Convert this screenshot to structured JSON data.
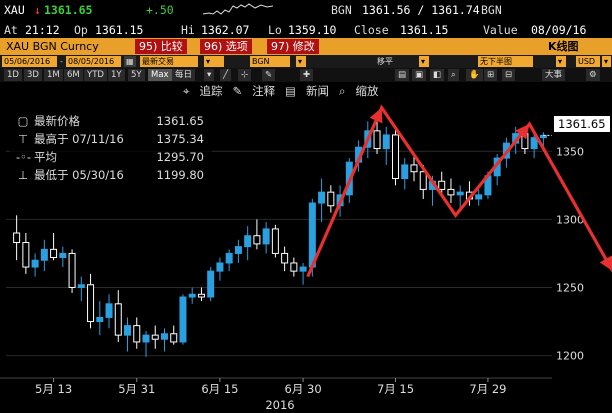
{
  "ticker": {
    "symbol": "XAU",
    "arrow": "↓",
    "last": "1361.65",
    "change": "+.50",
    "source": "BGN",
    "bid_ask": "1361.56 / 1361.74",
    "source2": "BGN",
    "at_label": "At",
    "time": "21:12",
    "op_label": "Op",
    "open": "1361.15",
    "hi_label": "Hi",
    "high": "1362.07",
    "lo_label": "Lo",
    "low": "1359.10",
    "close_label": "Close",
    "close": "1361.15",
    "value_label": "Value",
    "value_date": "08/09/16"
  },
  "function_bar": {
    "security": "XAU BGN Curncy",
    "btn1": "95) 比较",
    "btn2": "96) 选项",
    "btn3": "97) 修改",
    "chart_type": "K线图"
  },
  "controls": {
    "start_date": "05/06/2016",
    "dash": "-",
    "end_date": "08/05/2016",
    "trade_label": "最新交易",
    "source": "BGN",
    "pan_label": "移平",
    "no_half": "无下半图",
    "currency": "USD"
  },
  "periods": [
    "1D",
    "3D",
    "1M",
    "6M",
    "YTD",
    "1Y",
    "5Y",
    "Max",
    "每日"
  ],
  "toolbar": {
    "trace": "追踪",
    "annotate": "注释",
    "news": "新闻",
    "zoom": "缩放",
    "large": "大事"
  },
  "legend": {
    "rows": [
      {
        "label": "最新价格",
        "value": "1361.65"
      },
      {
        "label": "最高于 07/11/16",
        "value": "1375.34"
      },
      {
        "label": "平均",
        "value": "1295.70"
      },
      {
        "label": "最低于 05/30/16",
        "value": "1199.80"
      }
    ]
  },
  "last_price_tag": "1361.65",
  "colors": {
    "up": "#2aa0e0",
    "down": "#ffffff",
    "annotation": "#e83030",
    "function_bar": "#e8a02a",
    "positive_change": "#3ad13a"
  },
  "chart_data": {
    "type": "candlestick",
    "x_ticks": [
      "5月 13",
      "5月 31",
      "6月 15",
      "6月 30",
      "7月 15",
      "7月 29"
    ],
    "x_year": "2016",
    "y_ticks": [
      1200,
      1250,
      1300,
      1350
    ],
    "ylim": [
      1185,
      1395
    ],
    "candles": [
      {
        "o": 1290,
        "h": 1303,
        "l": 1270,
        "c": 1283
      },
      {
        "o": 1283,
        "h": 1290,
        "l": 1260,
        "c": 1265
      },
      {
        "o": 1265,
        "h": 1275,
        "l": 1258,
        "c": 1270
      },
      {
        "o": 1270,
        "h": 1285,
        "l": 1262,
        "c": 1278
      },
      {
        "o": 1278,
        "h": 1290,
        "l": 1270,
        "c": 1272
      },
      {
        "o": 1272,
        "h": 1280,
        "l": 1265,
        "c": 1275
      },
      {
        "o": 1275,
        "h": 1278,
        "l": 1246,
        "c": 1250
      },
      {
        "o": 1250,
        "h": 1258,
        "l": 1240,
        "c": 1252
      },
      {
        "o": 1252,
        "h": 1260,
        "l": 1220,
        "c": 1225
      },
      {
        "o": 1225,
        "h": 1240,
        "l": 1215,
        "c": 1228
      },
      {
        "o": 1228,
        "h": 1245,
        "l": 1220,
        "c": 1238
      },
      {
        "o": 1238,
        "h": 1248,
        "l": 1210,
        "c": 1215
      },
      {
        "o": 1215,
        "h": 1228,
        "l": 1203,
        "c": 1222
      },
      {
        "o": 1222,
        "h": 1228,
        "l": 1205,
        "c": 1210
      },
      {
        "o": 1210,
        "h": 1218,
        "l": 1199,
        "c": 1215
      },
      {
        "o": 1215,
        "h": 1222,
        "l": 1205,
        "c": 1212
      },
      {
        "o": 1212,
        "h": 1220,
        "l": 1203,
        "c": 1216
      },
      {
        "o": 1216,
        "h": 1222,
        "l": 1208,
        "c": 1210
      },
      {
        "o": 1210,
        "h": 1245,
        "l": 1208,
        "c": 1243
      },
      {
        "o": 1243,
        "h": 1250,
        "l": 1238,
        "c": 1245
      },
      {
        "o": 1245,
        "h": 1250,
        "l": 1240,
        "c": 1243
      },
      {
        "o": 1243,
        "h": 1265,
        "l": 1240,
        "c": 1262
      },
      {
        "o": 1262,
        "h": 1272,
        "l": 1255,
        "c": 1268
      },
      {
        "o": 1268,
        "h": 1278,
        "l": 1262,
        "c": 1275
      },
      {
        "o": 1275,
        "h": 1285,
        "l": 1268,
        "c": 1280
      },
      {
        "o": 1280,
        "h": 1295,
        "l": 1270,
        "c": 1288
      },
      {
        "o": 1288,
        "h": 1300,
        "l": 1278,
        "c": 1282
      },
      {
        "o": 1282,
        "h": 1298,
        "l": 1275,
        "c": 1293
      },
      {
        "o": 1293,
        "h": 1296,
        "l": 1272,
        "c": 1275
      },
      {
        "o": 1275,
        "h": 1280,
        "l": 1262,
        "c": 1268
      },
      {
        "o": 1268,
        "h": 1272,
        "l": 1258,
        "c": 1262
      },
      {
        "o": 1262,
        "h": 1268,
        "l": 1252,
        "c": 1265
      },
      {
        "o": 1265,
        "h": 1315,
        "l": 1258,
        "c": 1312
      },
      {
        "o": 1312,
        "h": 1330,
        "l": 1298,
        "c": 1320
      },
      {
        "o": 1320,
        "h": 1325,
        "l": 1305,
        "c": 1310
      },
      {
        "o": 1310,
        "h": 1325,
        "l": 1302,
        "c": 1318
      },
      {
        "o": 1318,
        "h": 1345,
        "l": 1312,
        "c": 1342
      },
      {
        "o": 1342,
        "h": 1358,
        "l": 1335,
        "c": 1353
      },
      {
        "o": 1353,
        "h": 1372,
        "l": 1345,
        "c": 1365
      },
      {
        "o": 1365,
        "h": 1375,
        "l": 1348,
        "c": 1352
      },
      {
        "o": 1352,
        "h": 1368,
        "l": 1340,
        "c": 1362
      },
      {
        "o": 1362,
        "h": 1368,
        "l": 1325,
        "c": 1330
      },
      {
        "o": 1330,
        "h": 1345,
        "l": 1322,
        "c": 1340
      },
      {
        "o": 1340,
        "h": 1348,
        "l": 1328,
        "c": 1335
      },
      {
        "o": 1335,
        "h": 1340,
        "l": 1315,
        "c": 1322
      },
      {
        "o": 1322,
        "h": 1332,
        "l": 1310,
        "c": 1328
      },
      {
        "o": 1328,
        "h": 1335,
        "l": 1318,
        "c": 1322
      },
      {
        "o": 1322,
        "h": 1330,
        "l": 1312,
        "c": 1318
      },
      {
        "o": 1318,
        "h": 1325,
        "l": 1308,
        "c": 1320
      },
      {
        "o": 1320,
        "h": 1328,
        "l": 1310,
        "c": 1315
      },
      {
        "o": 1315,
        "h": 1322,
        "l": 1310,
        "c": 1318
      },
      {
        "o": 1318,
        "h": 1335,
        "l": 1315,
        "c": 1332
      },
      {
        "o": 1332,
        "h": 1348,
        "l": 1325,
        "c": 1345
      },
      {
        "o": 1345,
        "h": 1360,
        "l": 1338,
        "c": 1356
      },
      {
        "o": 1356,
        "h": 1368,
        "l": 1348,
        "c": 1363
      },
      {
        "o": 1363,
        "h": 1366,
        "l": 1348,
        "c": 1352
      },
      {
        "o": 1352,
        "h": 1362,
        "l": 1345,
        "c": 1360
      },
      {
        "o": 1360,
        "h": 1364,
        "l": 1352,
        "c": 1361.65
      }
    ],
    "annotation_path": [
      [
        32,
        1258
      ],
      [
        40,
        1382
      ],
      [
        48,
        1303
      ],
      [
        56,
        1370
      ],
      [
        65,
        1262
      ]
    ]
  }
}
